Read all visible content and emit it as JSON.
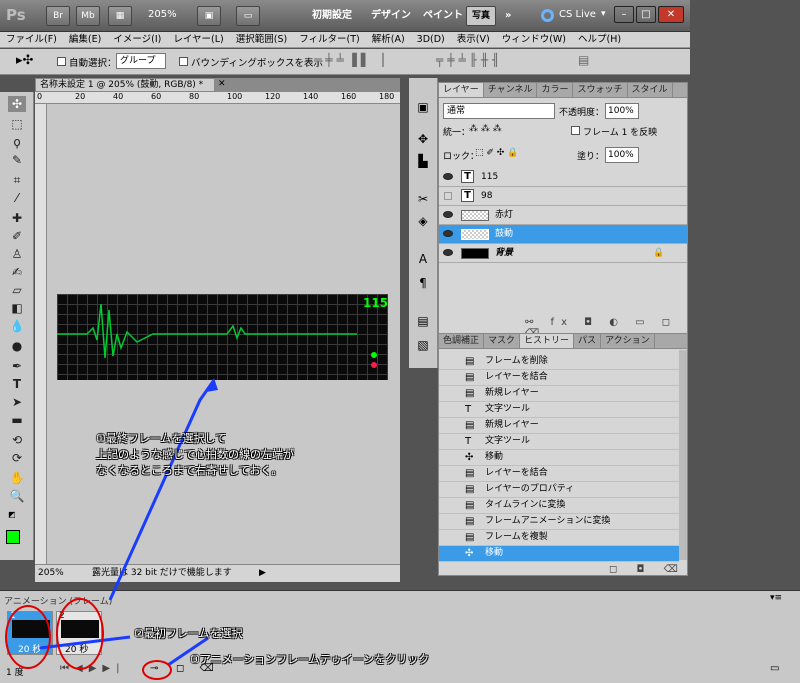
{
  "appbar": {
    "logo": "Ps",
    "br": "Br",
    "mb": "Mb",
    "zoom": "205%",
    "workspaces": [
      "初期設定",
      "デザイン",
      "ペイント",
      "写真"
    ],
    "active_ws": "写真",
    "more": "»",
    "cslive": "CS Live"
  },
  "menu": [
    "ファイル(F)",
    "編集(E)",
    "イメージ(I)",
    "レイヤー(L)",
    "選択範囲(S)",
    "フィルター(T)",
    "解析(A)",
    "3D(D)",
    "表示(V)",
    "ウィンドウ(W)",
    "ヘルプ(H)"
  ],
  "options": {
    "auto_select": "自動選択：",
    "auto_select_value": "グループ",
    "bbox_label": "バウンディングボックスを表示"
  },
  "document": {
    "tab_title": "名称未設定 1 @ 205% (鼓動, RGB/8) *",
    "ruler_ticks": [
      "0",
      "20",
      "40",
      "60",
      "80",
      "100",
      "120",
      "140",
      "160",
      "180"
    ],
    "monitor_value": "115",
    "zoom": "205%",
    "status": "露光量は 32 bit だけで機能します"
  },
  "layers_panel": {
    "tabs": [
      "レイヤー",
      "チャンネル",
      "カラー",
      "スウォッチ",
      "スタイル"
    ],
    "blend_mode": "通常",
    "opacity_label": "不透明度：",
    "opacity": "100%",
    "unify": "統一：",
    "propagate": "フレーム 1 を反映",
    "lock": "ロック：",
    "fill_label": "塗り：",
    "fill": "100%",
    "layers": [
      {
        "name": "115",
        "type": "text"
      },
      {
        "name": "98",
        "type": "text"
      },
      {
        "name": "赤灯",
        "type": "raster"
      },
      {
        "name": "鼓動",
        "type": "raster"
      },
      {
        "name": "背景",
        "type": "background"
      }
    ],
    "selected_layer": "鼓動"
  },
  "history_panel": {
    "tabs": [
      "色調補正",
      "マスク",
      "ヒストリー",
      "パス",
      "アクション"
    ],
    "items": [
      "フレームを削除",
      "レイヤーを結合",
      "新規レイヤー",
      "文字ツール",
      "新規レイヤー",
      "文字ツール",
      "移動",
      "レイヤーを結合",
      "レイヤーのプロパティ",
      "タイムラインに変換",
      "フレームアニメーションに変換",
      "フレームを複製",
      "移動"
    ],
    "selected_index": 12
  },
  "animation_panel": {
    "title": "アニメーション (フレーム)",
    "frames": [
      {
        "num": "1",
        "delay": "20 秒"
      },
      {
        "num": "2",
        "delay": "20 秒"
      }
    ],
    "loop": "1 度"
  },
  "annotations": {
    "note1": [
      "①最終フレームを選択して",
      "上記のような感じで心拍数の線の左端が",
      "なくなるところまで右寄せしておく。"
    ],
    "note2": "②最初フレームを選択",
    "note3": "③アニメーションフレームテゥイーンをクリック"
  },
  "colors": {
    "accent": "#3b9be6",
    "foreground": "#00ff00",
    "ecg": "#00cc33",
    "annotation": "#e00000",
    "arrow": "#1a3cff"
  }
}
